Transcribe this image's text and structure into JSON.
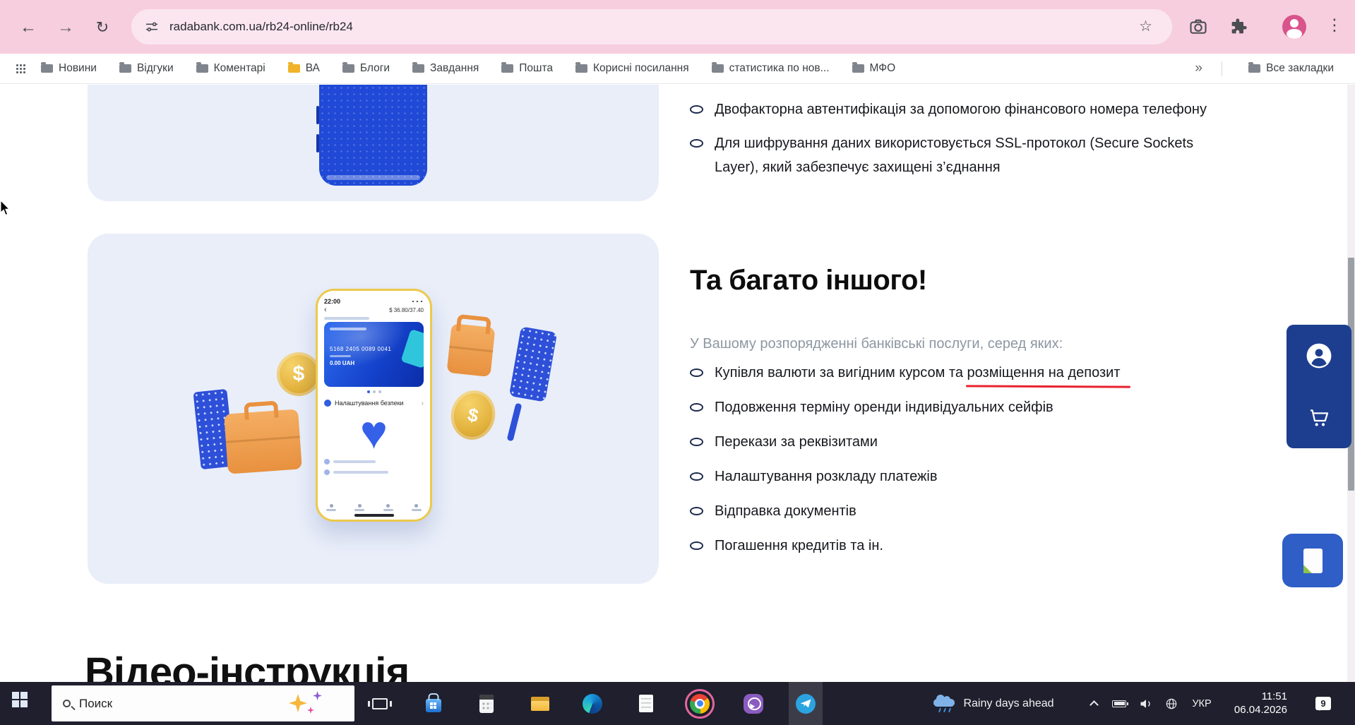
{
  "browser": {
    "url": "radabank.com.ua/rb24-online/rb24",
    "bookmarks": [
      "Новини",
      "Відгуки",
      "Коментарі",
      "ВА",
      "Блоги",
      "Завдання",
      "Пошта",
      "Корисні посилання",
      "статистика по нов...",
      "МФО"
    ],
    "overflow_chevron": "»",
    "all_bookmarks": "Все закладки"
  },
  "icons": {
    "back": "←",
    "forward": "→",
    "reload": "↻",
    "star": "☆",
    "menu": "⋮",
    "heart": "♥",
    "dollar": "$",
    "back_small": "‹",
    "chev_small": "›"
  },
  "page": {
    "security_bullets": [
      "Двофакторна автентифікація за допомогою фінансового номера телефону",
      "Для шифрування даних використовується SSL-протокол (Secure Sockets Layer), який забезпечує захищені з’єднання"
    ],
    "more_section": {
      "title": "Та багато іншого!",
      "subtitle": "У Вашому розпорядженні банківські послуги, серед яких:",
      "item1_pre": "Купівля валюти за вигідним курсом та ",
      "item1_marked": "розміщення на депозит",
      "items_rest": [
        "Подовження терміну оренди індивідуальних сейфів",
        "Перекази за реквізитами",
        "Налаштування розкладу платежів",
        "Відправка документів",
        "Погашення кредитів та ін."
      ]
    },
    "video_heading": "Відео-інструкція",
    "phone": {
      "time": "22:00",
      "rate": "$ 36.80/37.40",
      "card_number": "5168 2405 0089 0041",
      "balance": "0.00 UAH",
      "security_item": "Налаштування безпеки"
    }
  },
  "taskbar": {
    "search_placeholder": "Поиск",
    "weather": "Rainy days ahead",
    "language": "УКР",
    "time": "11:51",
    "date": "06.04.2026",
    "notification_count": "9"
  },
  "colors": {
    "theme_pink": "#f7cede",
    "omnibox_pink": "#fbe6f0",
    "card_bg": "#e9eef9",
    "navy_panel": "#1d3e8f",
    "doc_button_blue": "#2e5ec6",
    "red_underline": "#e8222d",
    "taskbar_dark": "#1f1f2d"
  }
}
